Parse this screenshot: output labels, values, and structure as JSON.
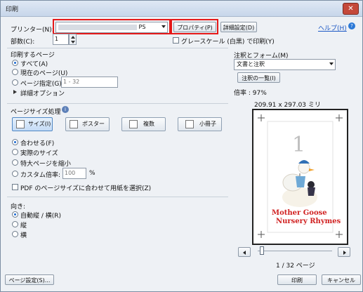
{
  "window": {
    "title": "印刷",
    "close": "✕"
  },
  "printer": {
    "label": "プリンター(N):",
    "selected": "PS",
    "properties_button": "プロパティ(P)",
    "advanced_button": "詳細設定(D)",
    "help_link": "ヘルプ(H)"
  },
  "copies": {
    "label": "部数(C):",
    "value": "1"
  },
  "grayscale": {
    "label": "グレースケール (白黒) で印刷(Y)",
    "checked": false
  },
  "pages": {
    "heading": "印刷するページ",
    "options": [
      {
        "label": "すべて(A)",
        "selected": true
      },
      {
        "label": "現在のページ(U)",
        "selected": false
      },
      {
        "label": "ページ指定(G)",
        "selected": false
      }
    ],
    "range_placeholder": "1 - 32",
    "more_options": "詳細オプション"
  },
  "sizing": {
    "heading": "ページサイズ処理",
    "buttons": [
      {
        "label": "サイズ(I)",
        "active": true
      },
      {
        "label": "ポスター",
        "active": false
      },
      {
        "label": "複数",
        "active": false
      },
      {
        "label": "小冊子",
        "active": false
      }
    ],
    "options": [
      {
        "label": "合わせる(F)",
        "selected": true
      },
      {
        "label": "実際のサイズ",
        "selected": false
      },
      {
        "label": "特大ページを縮小",
        "selected": false
      },
      {
        "label": "カスタム倍率:",
        "selected": false
      }
    ],
    "custom_scale": "100",
    "custom_unit": "%",
    "paper_source_label": "PDF のページサイズに合わせて用紙を選択(Z)"
  },
  "orientation": {
    "heading": "向き:",
    "options": [
      {
        "label": "自動縦 / 横(R)",
        "selected": true
      },
      {
        "label": "縦",
        "selected": false
      },
      {
        "label": "横",
        "selected": false
      }
    ]
  },
  "comments": {
    "heading": "注釈とフォーム(M)",
    "selected": "文書と注釈",
    "summary_button": "注釈の一覧(I)"
  },
  "preview": {
    "scale": "倍率 : 97%",
    "size": "209.91 x 297.03 ミリ",
    "page_number": "1",
    "title_line1": "Mother Goose",
    "title_line2": "Nursery Rhymes",
    "page_status": "1 / 32 ページ",
    "progress": 0.03
  },
  "footer": {
    "page_setup": "ページ設定(S)...",
    "print": "印刷",
    "cancel": "キャンセル"
  },
  "colors": {
    "accent": "#1d6bd4",
    "highlight": "#e51919",
    "preview_title": "#d01f1f"
  }
}
